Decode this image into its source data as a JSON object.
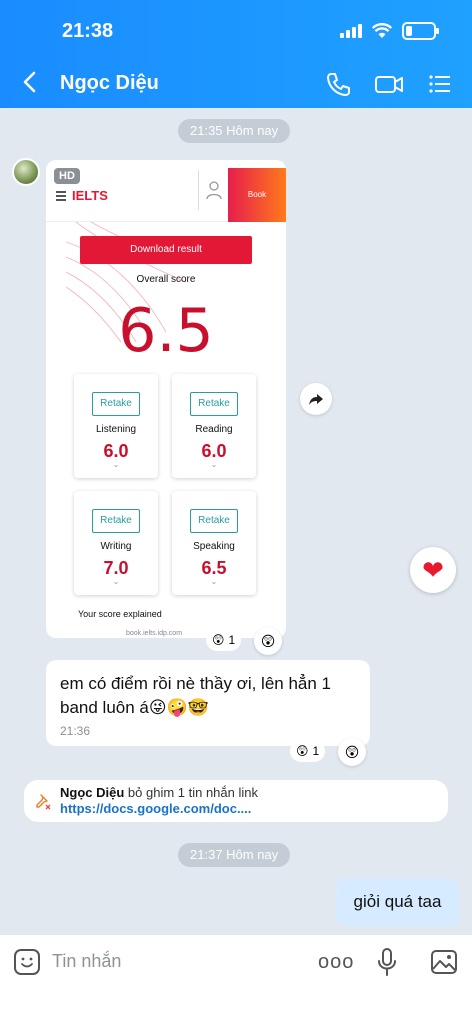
{
  "status_bar": {
    "time": "21:38"
  },
  "header": {
    "title": "Ngọc Diệu",
    "back_icon": "chevron-left-icon",
    "call_icon": "phone-icon",
    "video_icon": "video-camera-icon",
    "menu_icon": "list-menu-icon"
  },
  "chat": {
    "time_pill_1": "21:35 Hôm nay",
    "image_card": {
      "badge": "HD",
      "brand": "IELTS",
      "book_label": "Book",
      "download_label": "Download result",
      "overall_label": "Overall score",
      "overall_score": "6.5",
      "retake_label": "Retake",
      "scores": [
        {
          "name": "Listening",
          "value": "6.0"
        },
        {
          "name": "Reading",
          "value": "6.0"
        },
        {
          "name": "Writing",
          "value": "7.0"
        },
        {
          "name": "Speaking",
          "value": "6.5"
        }
      ],
      "explain": "Your score explained",
      "url": "book.ielts.idp.com"
    },
    "reaction_1": {
      "emoji": "😲",
      "count": "1"
    },
    "reaction_btn_1": "😲",
    "message_1": {
      "text": "em có điểm rồi nè thầy ơi, lên hẳn 1 band luôn á😜🤪🤓",
      "time": "21:36"
    },
    "reaction_2": {
      "emoji": "😲",
      "count": "1"
    },
    "reaction_btn_2": "😲",
    "heart": "❤",
    "pin_notice": {
      "name": "Ngọc Diệu",
      "text": " bỏ ghim 1 tin nhắn link ",
      "link": "https://docs.google.com/doc...."
    },
    "time_pill_2": "21:37 Hôm nay",
    "outgoing_message": "giỏi quá taa"
  },
  "input_bar": {
    "placeholder": "Tin nhắn",
    "more": "ooo"
  },
  "colors": {
    "header_blue": "#1a8cff",
    "score_red": "#c8102e",
    "retake_teal": "#2a9d9d",
    "outgoing_bubble": "#d6ebff"
  }
}
